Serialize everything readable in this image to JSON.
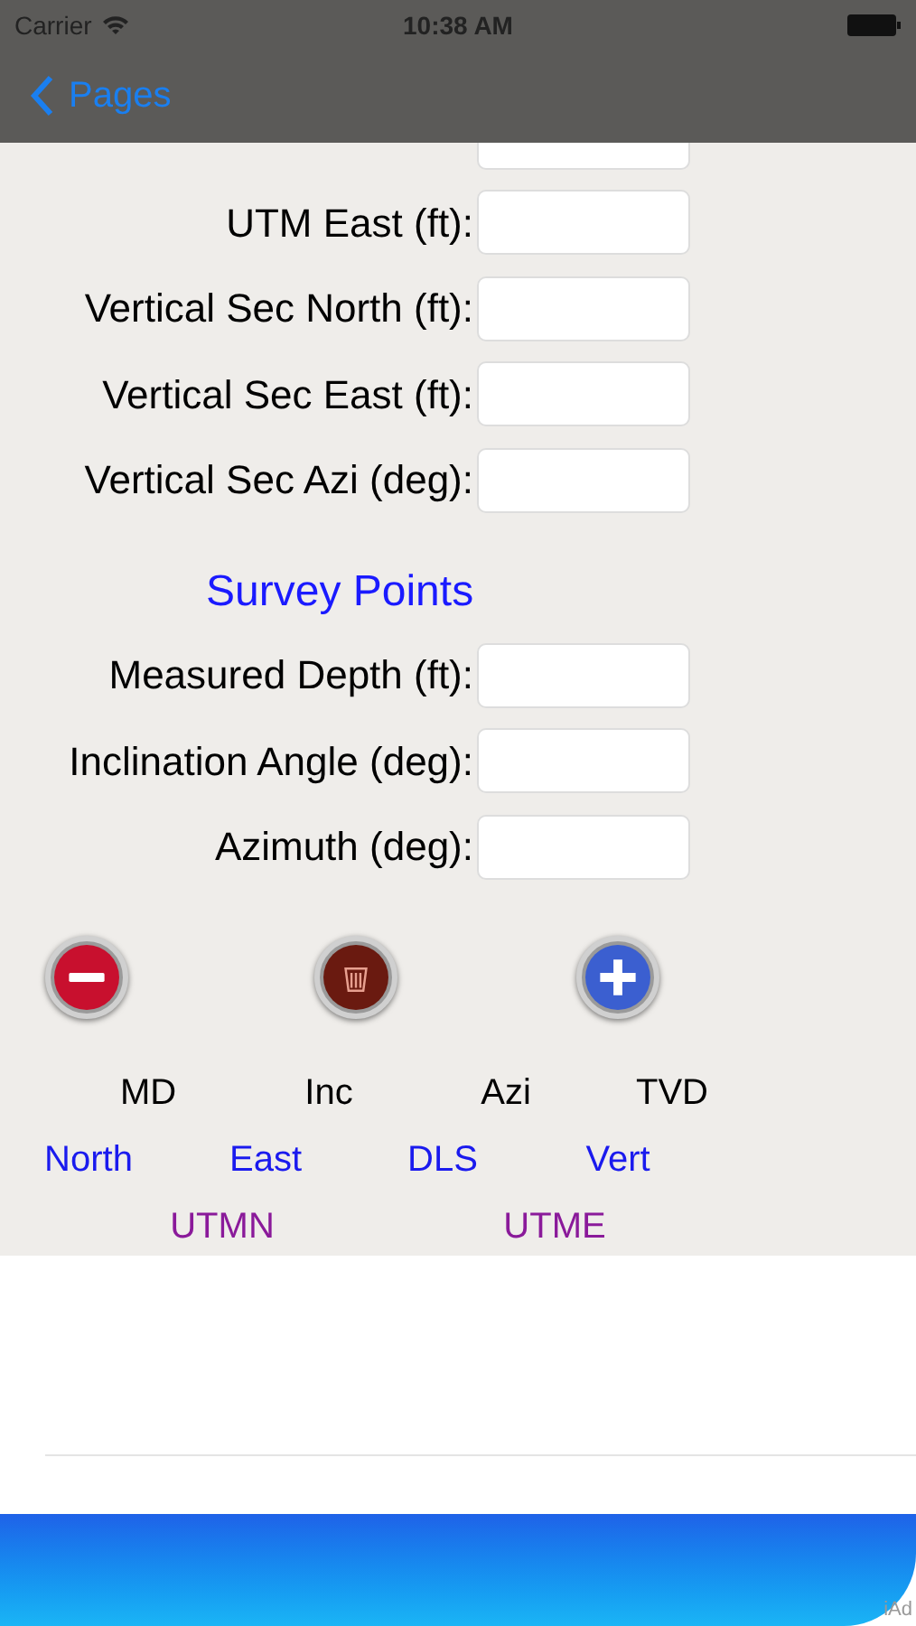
{
  "status_bar": {
    "carrier": "Carrier",
    "time": "10:38 AM"
  },
  "nav_bar": {
    "back": "Pages"
  },
  "fields": [
    {
      "label": "UTM East (ft):"
    },
    {
      "label": "Vertical Sec North (ft):"
    },
    {
      "label": "Vertical Sec East (ft):"
    },
    {
      "label": "Vertical Sec Azi (deg):"
    }
  ],
  "section_title": "Survey Points",
  "survey_fields": [
    {
      "label": "Measured Depth (ft):"
    },
    {
      "label": "Inclination Angle (deg):"
    },
    {
      "label": "Azimuth (deg):"
    }
  ],
  "buttons": [
    {
      "kind": "remove"
    },
    {
      "kind": "delete"
    },
    {
      "kind": "add"
    }
  ],
  "columns_row_1": [
    "MD",
    "Inc",
    "Azi",
    "TVD"
  ],
  "columns_row_2": [
    "North",
    "East",
    "DLS",
    "Vert"
  ],
  "columns_row_3": [
    "UTMN",
    "UTME"
  ],
  "ad_banner": {
    "badge": "iAd"
  }
}
